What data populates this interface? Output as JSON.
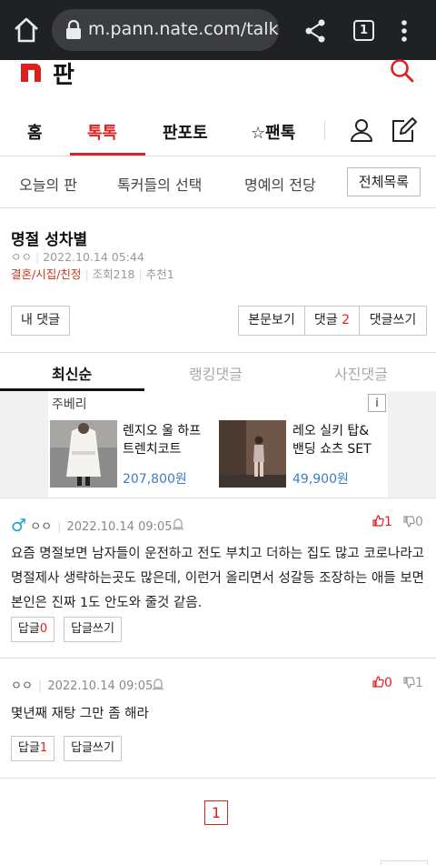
{
  "browser": {
    "url": "m.pann.nate.com/talk/re",
    "tab_count": "1"
  },
  "header": {
    "site_name": "판",
    "logo_letter": "n",
    "brand_color": "#e0201f"
  },
  "gnb": {
    "items": [
      "홈",
      "톡톡",
      "판포토",
      "☆팬톡"
    ],
    "active": "톡톡"
  },
  "subnav": {
    "items": [
      "오늘의 판",
      "톡커들의 선택",
      "명예의 전당"
    ],
    "all_button": "전체목록"
  },
  "post": {
    "title": "명절 성차별",
    "author": "ㅇㅇ",
    "date": "2022.10.14 05:44",
    "category": "결혼/시집/친정",
    "views": "조회218",
    "recommends": "추천1"
  },
  "actions": {
    "my_comments": "내 댓글",
    "view_post": "본문보기",
    "comments_label": "댓글",
    "comments_count": "2",
    "write_comment": "댓글쓰기"
  },
  "comment_tabs": [
    "최신순",
    "랭킹댓글",
    "사진댓글"
  ],
  "ad": {
    "brand": "주베리",
    "info": "i",
    "products": [
      {
        "name": "렌지오 울 하프 트렌치코트",
        "price": "207,800원"
      },
      {
        "name": "레오 실키 탑& 밴딩 쇼츠 SET",
        "price": "49,900원"
      }
    ]
  },
  "comments": [
    {
      "gender_icon": "♂",
      "nick": "ㅇㅇ",
      "date": "2022.10.14 09:05",
      "text": "요즘 명절보면 남자들이 운전하고 전도 부치고 더하는 집도 많고 코로나라고 명절제사 생략하는곳도 많은데, 이런거 올리면서 성갈등 조장하는 애들 보면 본인은 진짜 1도 안도와 줄것 같음.",
      "up": "1",
      "down": "0",
      "reply_label": "답글",
      "reply_count": "0",
      "write_reply": "답글쓰기"
    },
    {
      "nick": "ㅇㅇ",
      "date": "2022.10.14 09:05",
      "text": "몇년째 재탕 그만 좀 해라",
      "up": "0",
      "down": "1",
      "reply_label": "답글",
      "reply_count": "1",
      "write_reply": "답글쓰기"
    }
  ],
  "pagination": {
    "current": "1"
  }
}
